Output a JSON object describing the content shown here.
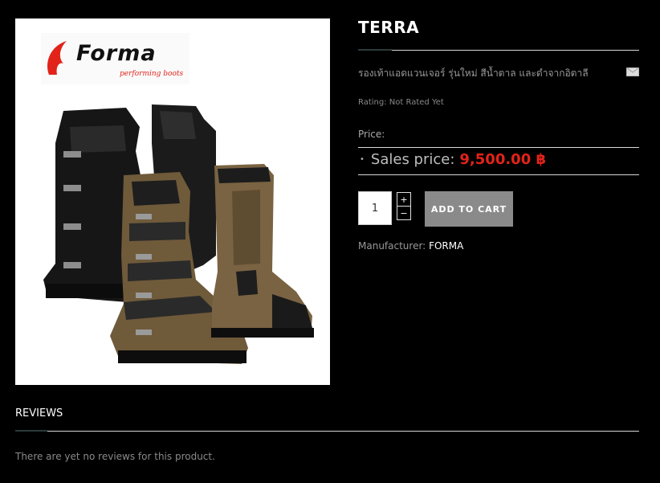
{
  "product": {
    "title": "TERRA",
    "description": "รองเท้าแอดแวนเจอร์ รุ่นใหม่ สีน้ำตาล และดำจากอิตาลี",
    "rating": "Rating: Not Rated Yet",
    "price_label": "Price:",
    "sales_price_label": "Sales price:",
    "sales_price_value": "9,500.00 ฿",
    "quantity": "1",
    "add_to_cart_label": "ADD TO CART",
    "manufacturer_label": "Manufacturer:",
    "manufacturer_name": "FORMA",
    "stepper_plus": "+",
    "stepper_minus": "−",
    "image_logo_text": "Forma",
    "image_logo_tagline": "performing boots"
  },
  "reviews": {
    "title": "REVIEWS",
    "empty_text": "There are yet no reviews for this product."
  },
  "colors": {
    "accent": "#e2231a",
    "button": "#8a8a8a",
    "background": "#000000"
  },
  "icons": {
    "ask_question": "mail-icon"
  }
}
